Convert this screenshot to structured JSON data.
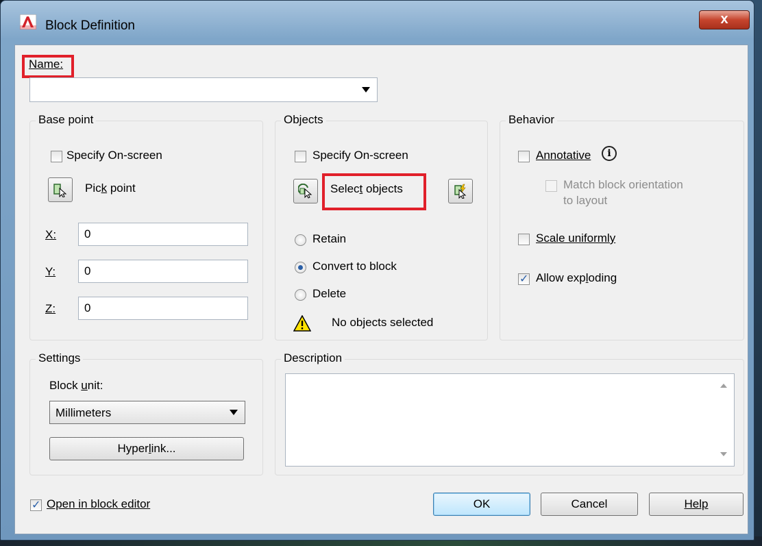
{
  "window": {
    "title": "Block Definition",
    "close_glyph": "x"
  },
  "name": {
    "label": "Name:",
    "value": ""
  },
  "base_point": {
    "title": "Base point",
    "specify_on_screen": {
      "label": "Specify On-screen",
      "checked": false
    },
    "pick_point": {
      "label_pre": "Pic",
      "label_u": "k",
      "label_post": " point"
    },
    "x": {
      "label": "X:",
      "value": "0"
    },
    "y": {
      "label": "Y:",
      "value": "0"
    },
    "z": {
      "label": "Z:",
      "value": "0"
    }
  },
  "objects": {
    "title": "Objects",
    "specify_on_screen": {
      "label": "Specify On-screen",
      "checked": false
    },
    "select_objects": {
      "label_pre": "Selec",
      "label_u": "t",
      "label_post": " objects"
    },
    "retain": {
      "label": "Retain",
      "checked": false
    },
    "convert": {
      "label": "Convert to block",
      "checked": true
    },
    "delete": {
      "label": "Delete",
      "checked": false
    },
    "status": "No objects selected"
  },
  "behavior": {
    "title": "Behavior",
    "annotative": {
      "label": "Annotative",
      "checked": false
    },
    "match": {
      "label_line1": "Match block orientation",
      "label_line2": "to layout",
      "checked": false
    },
    "scale": {
      "label": "Scale uniformly",
      "checked": false
    },
    "explode": {
      "label_pre": "Allow exp",
      "label_u": "l",
      "label_post": "oding",
      "checked": true
    }
  },
  "settings": {
    "title": "Settings",
    "block_unit_label_pre": "Block ",
    "block_unit_label_u": "u",
    "block_unit_label_post": "nit:",
    "unit_value": "Millimeters",
    "hyperlink_pre": "Hyper",
    "hyperlink_u": "l",
    "hyperlink_post": "ink..."
  },
  "description": {
    "title": "Description",
    "value": ""
  },
  "open_in_editor": {
    "label": "Open in block editor",
    "checked": true
  },
  "buttons": {
    "ok": "OK",
    "cancel": "Cancel",
    "help": "Help"
  },
  "colors": {
    "highlight": "#e1202a",
    "title_bar": "#7fa6c9",
    "dialog_bg": "#f0f0f0"
  }
}
